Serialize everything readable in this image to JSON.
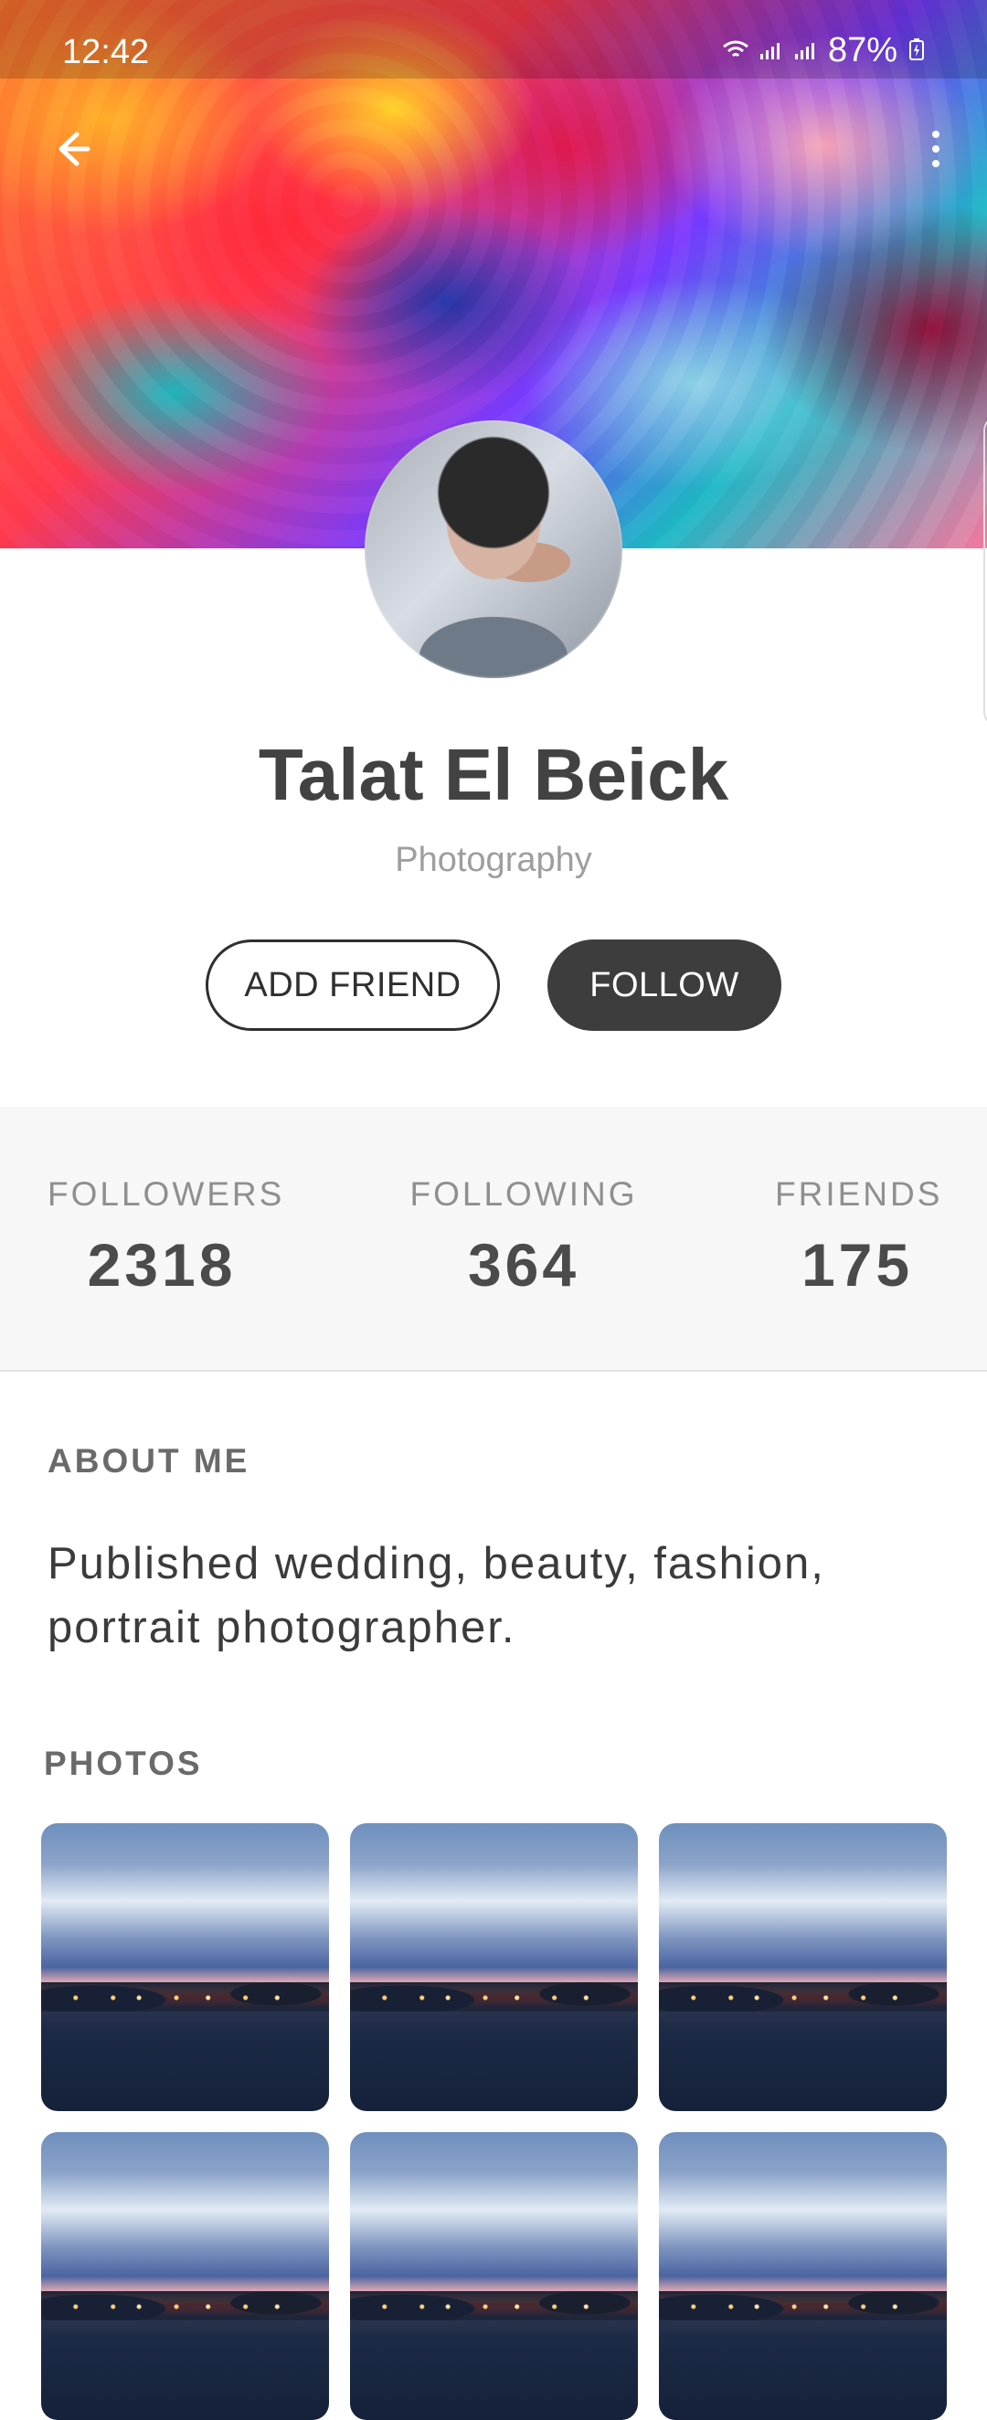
{
  "status_bar": {
    "time": "12:42",
    "battery": "87%"
  },
  "profile": {
    "name": "Talat El Beick",
    "role": "Photography",
    "buttons": {
      "add_friend": "ADD FRIEND",
      "follow": "FOLLOW"
    },
    "stats": {
      "followers_label": "FOLLOWERS",
      "followers_value": "2318",
      "following_label": "FOLLOWING",
      "following_value": "364",
      "friends_label": "FRIENDS",
      "friends_value": "175"
    },
    "about": {
      "title": "ABOUT ME",
      "text": "Published wedding, beauty, fashion, portrait photographer."
    },
    "photos": {
      "title": "PHOTOS"
    }
  },
  "icons": {
    "back": "back-arrow-icon",
    "more": "more-vertical-icon",
    "wifi": "wifi-icon",
    "signal": "signal-icon",
    "battery": "battery-icon"
  },
  "colors": {
    "primary_dark": "#3d3d3d",
    "text_primary": "#424242",
    "text_secondary": "#9e9e9e",
    "background": "#ffffff",
    "divider": "#e3e3e3"
  }
}
